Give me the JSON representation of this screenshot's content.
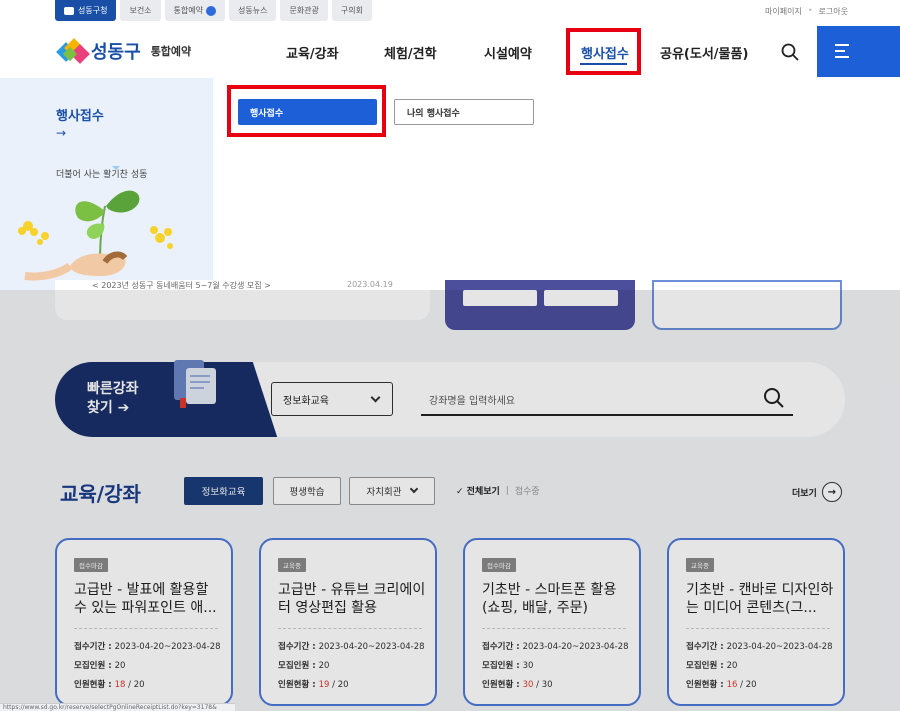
{
  "topbar": {
    "tabs": [
      {
        "label": "성동구청",
        "active": true
      },
      {
        "label": "보건소"
      },
      {
        "label": "통합예약"
      },
      {
        "label": "성동뉴스"
      },
      {
        "label": "문화관광"
      },
      {
        "label": "구의회"
      }
    ],
    "util": {
      "mypage": "마이페이지",
      "logout": "로그아웃"
    }
  },
  "header": {
    "logo_name": "성동구",
    "logo_sub": "통합예약",
    "nav": [
      {
        "label": "교육/강좌"
      },
      {
        "label": "체험/견학"
      },
      {
        "label": "시설예약"
      },
      {
        "label": "행사접수",
        "active": true
      },
      {
        "label": "공유(도서/물품)"
      }
    ]
  },
  "dropdown": {
    "title": "행사접수",
    "arrow": "→",
    "slogan": "더불어 사는 활기찬 성동",
    "submenu": [
      {
        "label": "행사접수",
        "active": true
      },
      {
        "label": "나의 행사접수"
      }
    ]
  },
  "peek": {
    "notice_title": "< 2023년 성동구 동네배움터 5~7월 수강생 모집 >",
    "notice_date": "2023.04.19"
  },
  "quick": {
    "title_line1": "빠른강좌",
    "title_line2": "찾기 ➔",
    "select_value": "정보화교육",
    "input_placeholder": "강좌명을 입력하세요"
  },
  "section": {
    "title": "교육/강좌",
    "filters": [
      "정보화교육",
      "평생학습",
      "자치회관"
    ],
    "view_all": "✓ 전체보기",
    "view_sep": "|",
    "view_open": "접수중",
    "more": "더보기",
    "more_icon": "→"
  },
  "cards": [
    {
      "badge": "접수마감",
      "title": "고급반 - 발표에 활용할 수 있는 파워포인트 애...",
      "period_label": "접수기간 : ",
      "period": "2023-04-20~2023-04-28",
      "quota_label": "모집인원 : ",
      "quota": "20",
      "status_label": "인원현황 : ",
      "current": "18",
      "total": " / 20"
    },
    {
      "badge": "교육중",
      "title": "고급반 - 유튜브 크리에이터 영상편집 활용",
      "period_label": "접수기간 : ",
      "period": "2023-04-20~2023-04-28",
      "quota_label": "모집인원 : ",
      "quota": "20",
      "status_label": "인원현황 : ",
      "current": "19",
      "total": " / 20"
    },
    {
      "badge": "접수마감",
      "title": "기초반 - 스마트폰 활용(쇼핑, 배달, 주문)",
      "period_label": "접수기간 : ",
      "period": "2023-04-20~2023-04-28",
      "quota_label": "모집인원 : ",
      "quota": "30",
      "status_label": "인원현황 : ",
      "current": "30",
      "total": " / 30"
    },
    {
      "badge": "교육중",
      "title": "기초반 - 캔바로 디자인하는 미디어 콘텐츠(그...",
      "period_label": "접수기간 : ",
      "period": "2023-04-20~2023-04-28",
      "quota_label": "모집인원 : ",
      "quota": "20",
      "status_label": "인원현황 : ",
      "current": "16",
      "total": " / 20"
    }
  ],
  "statusbar": {
    "url": "https://www.sd.go.kr/reserve/selectPgOnlineReceiptList.do?key=3178&"
  },
  "colors": {
    "brand": "#1a4fa8",
    "menu_button": "#1c5fd6",
    "highlight_box": "#e60012",
    "badge_dark": "#1a2f6b"
  }
}
